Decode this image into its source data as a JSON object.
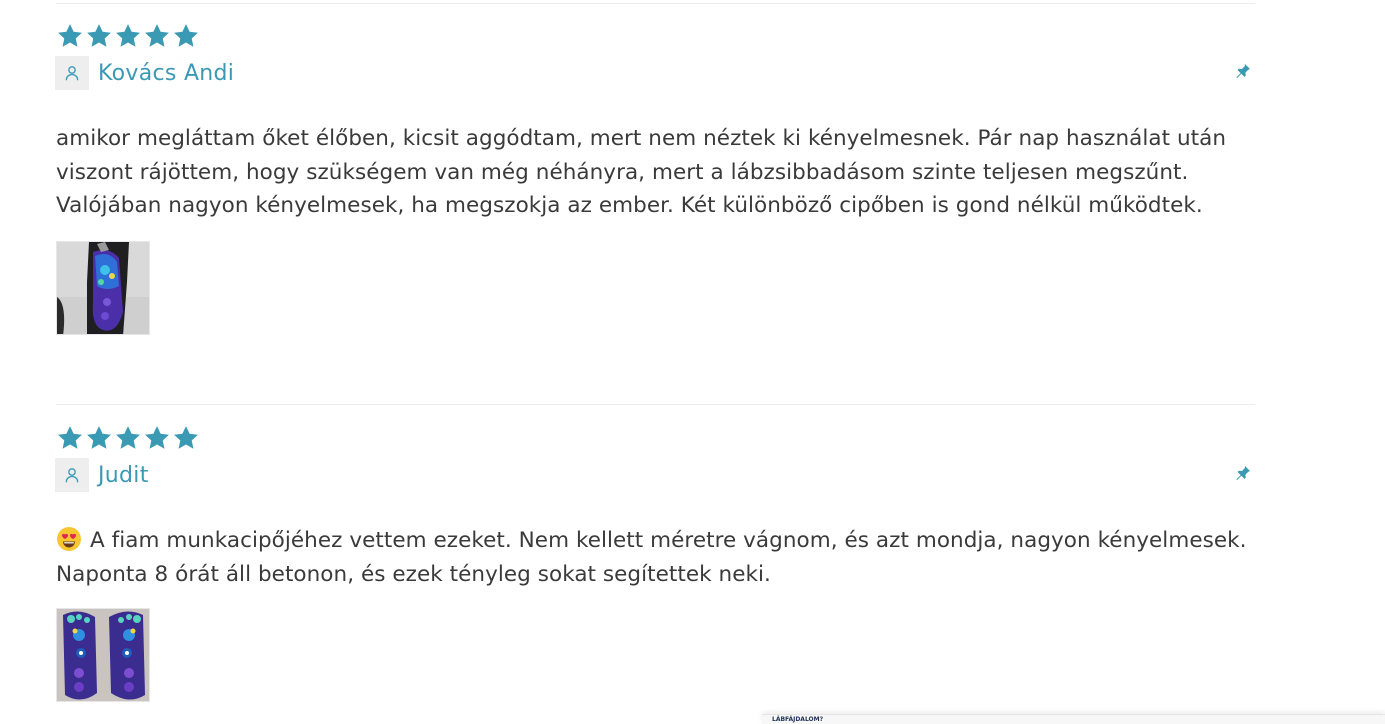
{
  "colors": {
    "accent": "#3a9ab4",
    "text": "#3a3a3a",
    "divider": "#ececec",
    "avatar_bg": "#eeeeee"
  },
  "reviews": [
    {
      "rating": 5,
      "star_icon": "star-icon",
      "author": "Kovács Andi",
      "pinned_icon": "pin-icon",
      "emoji": "",
      "text": "amikor megláttam őket élőben, kicsit aggódtam, mert nem néztek ki kényelmesnek. Pár nap használat után viszont rájöttem, hogy szükségem van még néhányra, mert a lábzsibbadásom szinte teljesen megszűnt. Valójában nagyon kényelmesek, ha megszokja az ember. Két különböző cipőben is gond nélkül működtek.",
      "photo": "insole-in-shoe-photo"
    },
    {
      "rating": 5,
      "star_icon": "star-icon",
      "author": "Judit",
      "pinned_icon": "pin-icon",
      "emoji": "heart-eyes-emoji",
      "text": "A fiam munkacipőjéhez vettem ezeket. Nem kellett méretre vágnom, és azt mondja, nagyon kényelmesek. Naponta 8 órát áll betonon, és ezek tényleg sokat segítettek neki.",
      "photo": "insole-pair-photo"
    }
  ],
  "popup": {
    "label": "LÁBFÁJDALOM?"
  }
}
